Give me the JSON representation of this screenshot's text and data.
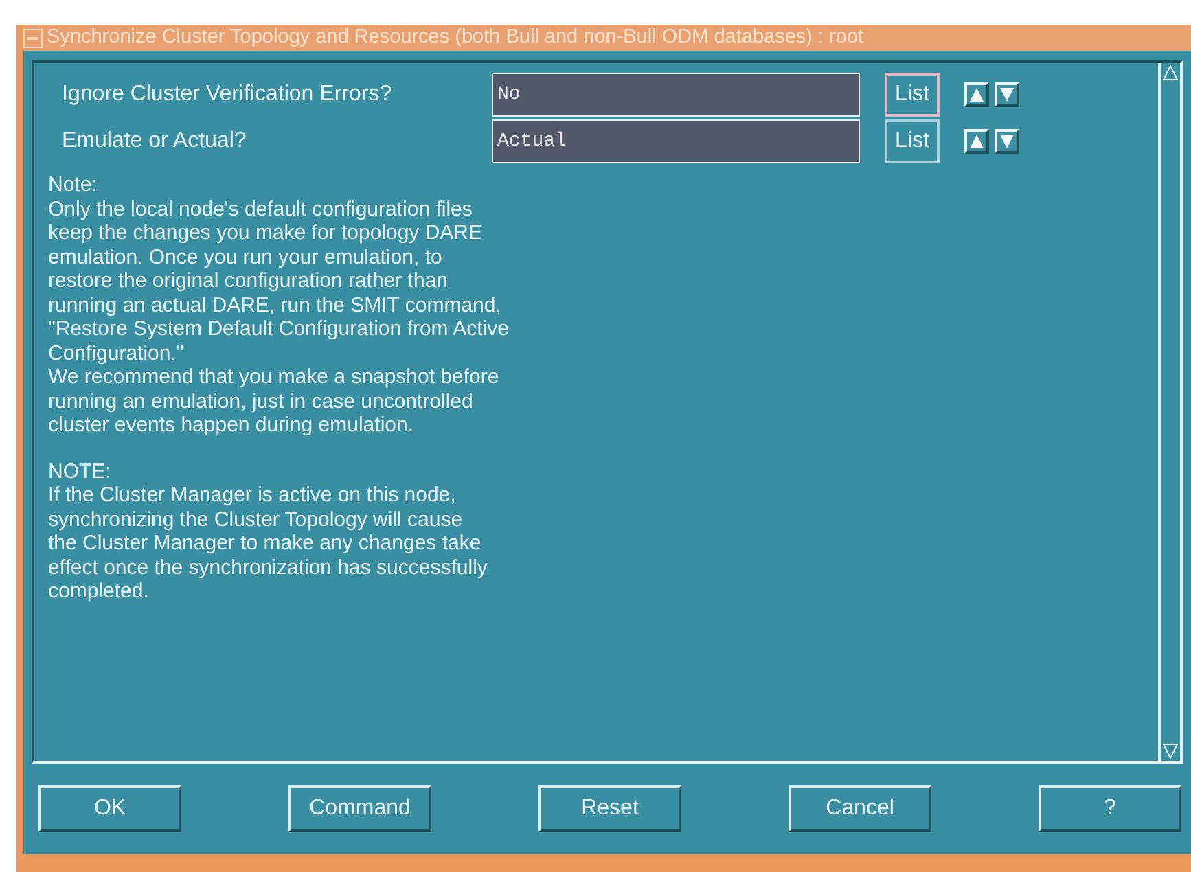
{
  "window": {
    "title": "Synchronize Cluster Topology and Resources (both Bull and non-Bull ODM databases) : root"
  },
  "fields": [
    {
      "label": "Ignore Cluster Verification Errors?",
      "value": "No",
      "list_button": "List",
      "focused": true
    },
    {
      "label": "Emulate or Actual?",
      "value": "Actual",
      "list_button": "List",
      "focused": false
    }
  ],
  "notes": [
    [
      "Note:",
      "Only the local node's default configuration files",
      "keep the changes you make for topology DARE",
      "emulation. Once you run your emulation, to",
      "restore the original configuration rather than",
      "running an actual DARE, run the SMIT command,",
      "\"Restore System Default Configuration from Active",
      "Configuration.\"",
      "We recommend that you make a snapshot before",
      "running an emulation, just in case uncontrolled",
      "cluster events happen during emulation."
    ],
    [
      "NOTE:",
      "If the Cluster Manager is active on this node,",
      "synchronizing the Cluster Topology will cause",
      "the Cluster Manager to make any changes take",
      "effect once the synchronization has successfully",
      "completed."
    ]
  ],
  "buttons": [
    "OK",
    "Command",
    "Reset",
    "Cancel",
    "?"
  ]
}
